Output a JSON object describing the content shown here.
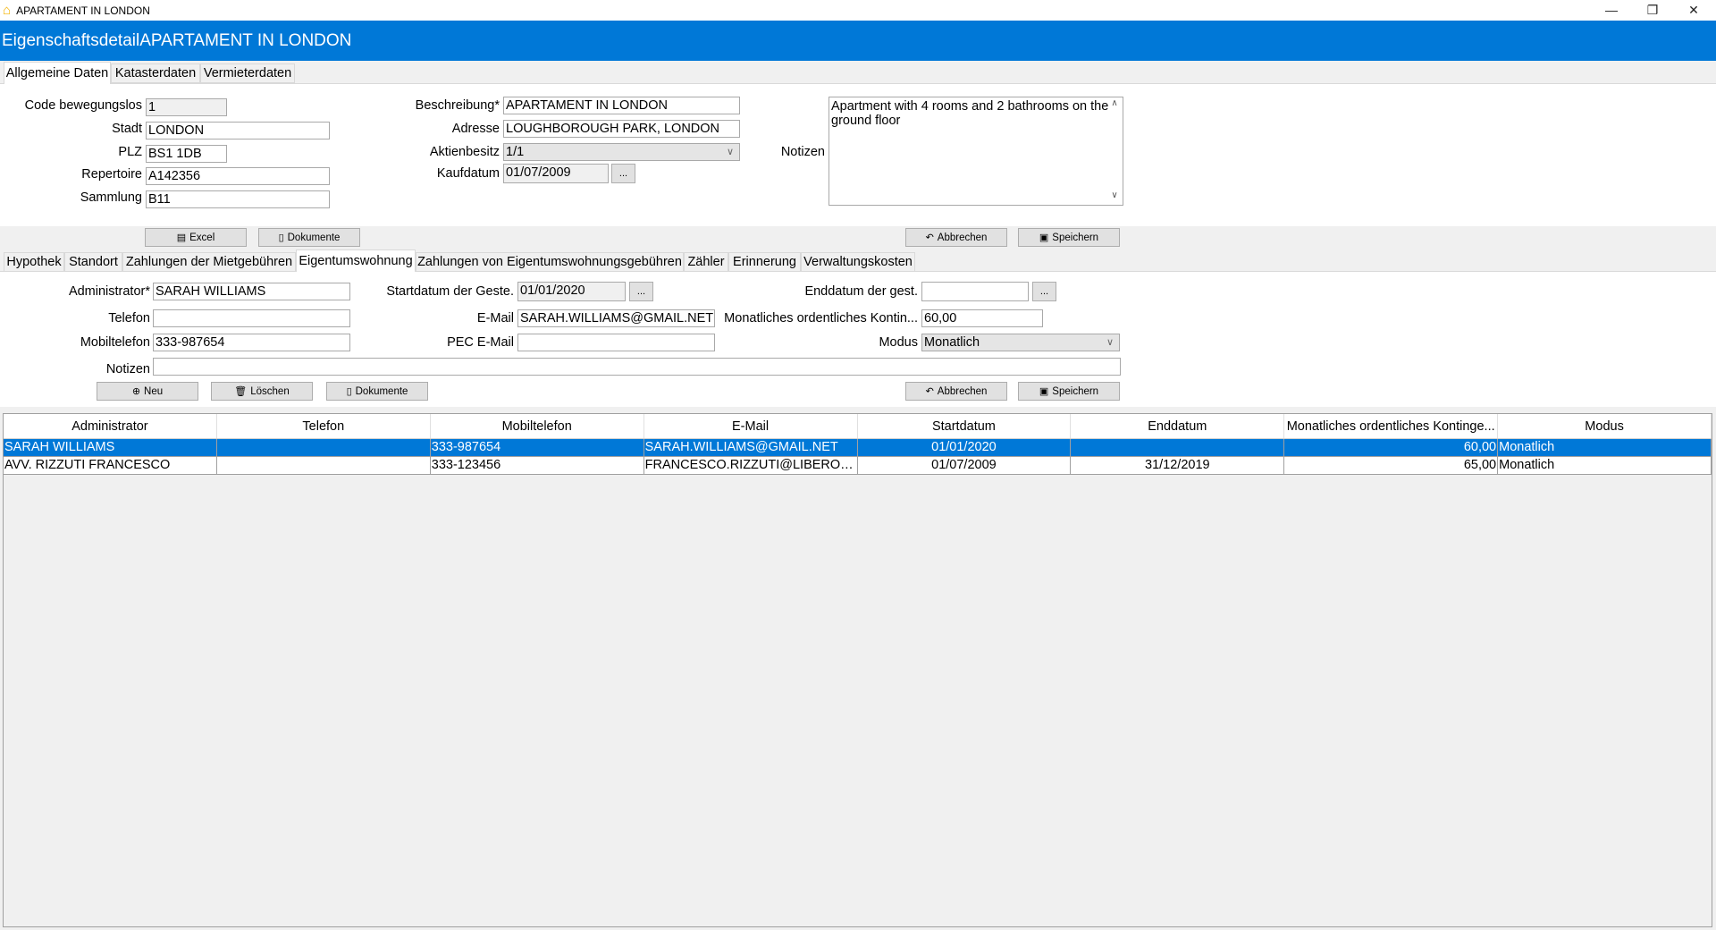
{
  "window": {
    "title": "APARTAMENT IN LONDON",
    "icon": "house-icon"
  },
  "header": {
    "title": "EigenschaftsdetailAPARTAMENT IN LONDON"
  },
  "top_tabs": [
    {
      "label": "Allgemeine Daten",
      "selected": true
    },
    {
      "label": "Katasterdaten"
    },
    {
      "label": "Vermieterdaten"
    }
  ],
  "general": {
    "code_label": "Code bewegungslos",
    "code": "1",
    "stadt_label": "Stadt",
    "stadt": "LONDON",
    "plz_label": "PLZ",
    "plz": "BS1 1DB",
    "repertoire_label": "Repertoire",
    "repertoire": "A142356",
    "sammlung_label": "Sammlung",
    "sammlung": "B11",
    "beschreibung_label": "Beschreibung*",
    "beschreibung": "APARTAMENT IN LONDON",
    "adresse_label": "Adresse",
    "adresse": "LOUGHBOROUGH PARK, LONDON",
    "aktienbesitz_label": "Aktienbesitz",
    "aktienbesitz": "1/1",
    "kaufdatum_label": "Kaufdatum",
    "kaufdatum": "01/07/2009",
    "notizen_label": "Notizen",
    "notizen": "Apartment with 4 rooms and 2 bathrooms on the ground floor",
    "excel": "Excel",
    "dokumente": "Dokumente",
    "abbrechen": "Abbrechen",
    "speichern": "Speichern",
    "dots": "..."
  },
  "sub_tabs": [
    {
      "label": "Hypothek"
    },
    {
      "label": "Standort"
    },
    {
      "label": "Zahlungen der Mietgebühren"
    },
    {
      "label": "Eigentumswohnung",
      "selected": true
    },
    {
      "label": "Zahlungen von Eigentumswohnungsgebühren"
    },
    {
      "label": "Zähler"
    },
    {
      "label": "Erinnerung"
    },
    {
      "label": "Verwaltungskosten"
    }
  ],
  "condo": {
    "admin_label": "Administrator*",
    "admin": "SARAH WILLIAMS",
    "telefon_label": "Telefon",
    "telefon": "",
    "mobil_label": "Mobiltelefon",
    "mobil": "333-987654",
    "notizen_label": "Notizen",
    "notizen": "",
    "start_label": "Startdatum der Geste.",
    "start": "01/01/2020",
    "email_label": "E-Mail",
    "email": "SARAH.WILLIAMS@GMAIL.NET",
    "pec_label": "PEC E-Mail",
    "pec": "",
    "end_label": "Enddatum der gest.",
    "end": "",
    "monthly_label": "Monatliches ordentliches Kontin...",
    "monthly": "60,00",
    "modus_label": "Modus",
    "modus": "Monatlich",
    "neu": "Neu",
    "loeschen": "Löschen",
    "dokumente": "Dokumente",
    "abbrechen": "Abbrechen",
    "speichern": "Speichern",
    "dots": "..."
  },
  "table": {
    "columns": [
      "Administrator",
      "Telefon",
      "Mobiltelefon",
      "E-Mail",
      "Startdatum",
      "Enddatum",
      "Monatliches ordentliches Kontinge...",
      "Modus"
    ],
    "rows": [
      [
        "SARAH WILLIAMS",
        "",
        "333-987654",
        "SARAH.WILLIAMS@GMAIL.NET",
        "01/01/2020",
        "",
        "60,00",
        "Monatlich"
      ],
      [
        "AVV. RIZZUTI FRANCESCO",
        "",
        "333-123456",
        "FRANCESCO.RIZZUTI@LIBERO.C...",
        "01/07/2009",
        "31/12/2019",
        "65,00",
        "Monatlich"
      ]
    ],
    "selected_row": 0
  },
  "colors": {
    "accent": "#0078d7"
  }
}
